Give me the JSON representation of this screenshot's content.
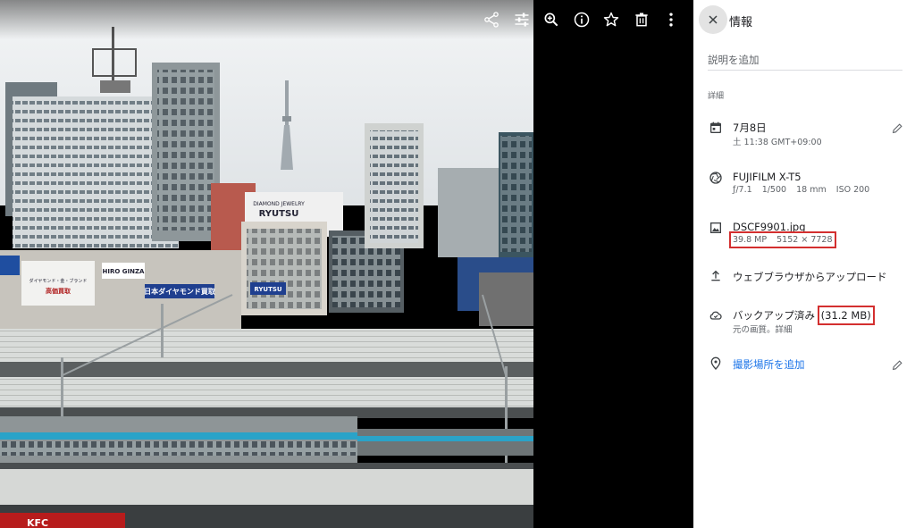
{
  "viewer": {
    "toolbar": {
      "share_icon": "share-icon",
      "edit_icon": "tune-icon",
      "zoom_icon": "zoom-in-icon",
      "info_icon": "info-icon",
      "favorite_icon": "star-outline-icon",
      "delete_icon": "trash-icon",
      "more_icon": "more-vert-icon"
    },
    "photo": {
      "building_sign_1": "DIAMOND JEWELRY",
      "building_sign_2": "RYUTSU",
      "building_sign_3": "HIRO GINZA",
      "building_sign_4": "日本ダイヤモンド買取",
      "building_sign_5": "RYUTSU",
      "building_sign_6": "ダイヤモンド・金・ブランド",
      "building_sign_7": "高価買取",
      "building_sign_8": "KFC"
    }
  },
  "panel": {
    "title": "情報",
    "description_placeholder": "説明を追加",
    "section_label": "詳細",
    "date": {
      "main": "7月8日",
      "sub": "土 11:38   GMT+09:00"
    },
    "camera": {
      "main": "FUJIFILM X-T5",
      "aperture": "ƒ/7.1",
      "shutter": "1/500",
      "focal": "18 mm",
      "iso": "ISO 200"
    },
    "file": {
      "name": "DSCF9901.jpg",
      "megapixels": "39.8 MP",
      "dimensions": "5152 × 7728"
    },
    "upload": {
      "main": "ウェブブラウザからアップロード"
    },
    "backup": {
      "main": "バックアップ済み",
      "size": "(31.2 MB)",
      "quality": "元の画質。",
      "details_link": "詳細"
    },
    "location": {
      "main": "撮影場所を追加"
    }
  },
  "colors": {
    "highlight": "#d32f2f",
    "link": "#1a73e8",
    "panel_bg": "#ffffff"
  }
}
